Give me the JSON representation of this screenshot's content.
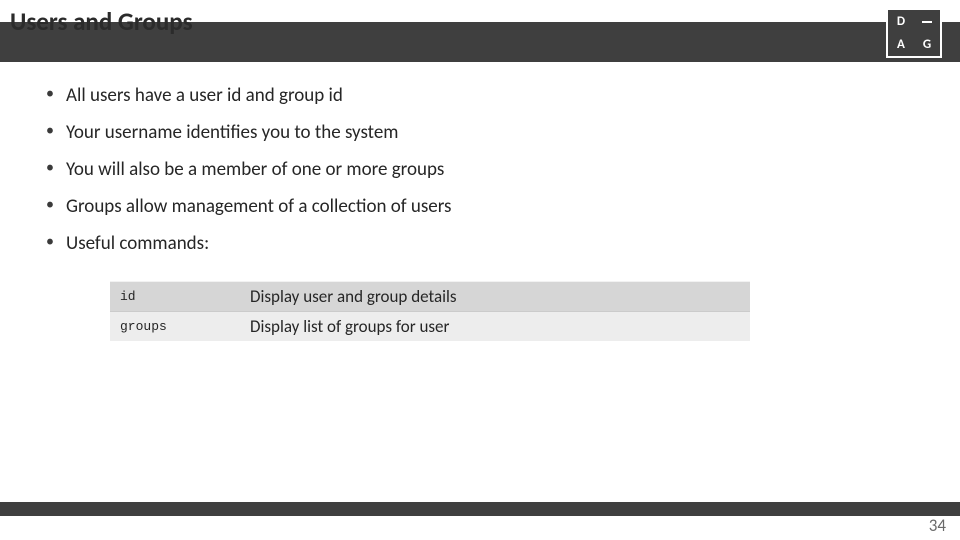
{
  "header": {
    "title": "Users and Groups",
    "logo": {
      "tl": "D",
      "bl": "A",
      "br": "G"
    }
  },
  "bullets": [
    "All users have a user id and group id",
    "Your username identifies you to the system",
    "You will also be a member of one or more groups",
    "Groups allow management of a collection of users",
    "Useful commands:"
  ],
  "commands": [
    {
      "cmd": "id",
      "desc": "Display user and group details"
    },
    {
      "cmd": "groups",
      "desc": "Display list of groups for user"
    }
  ],
  "page_number": "34"
}
